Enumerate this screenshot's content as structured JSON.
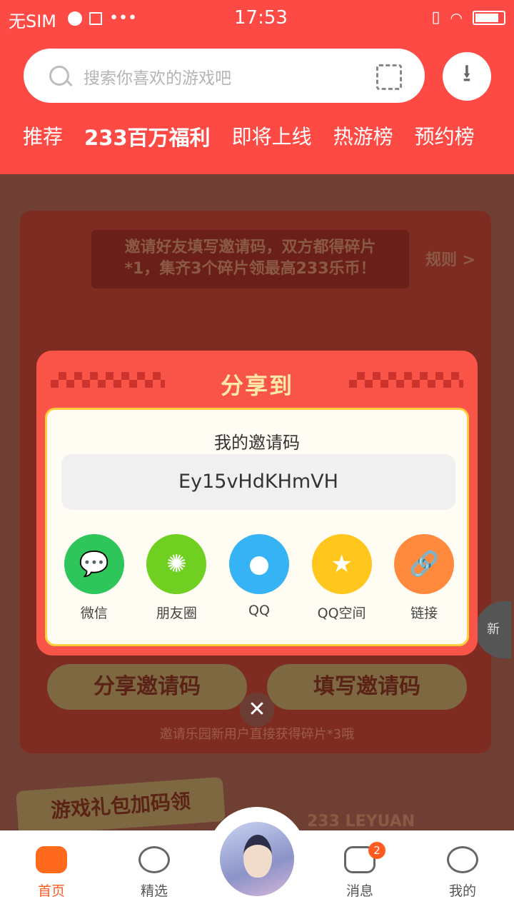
{
  "status_bar": {
    "carrier": "无SIM",
    "time": "17:53"
  },
  "search": {
    "placeholder": "搜索你喜欢的游戏吧"
  },
  "tabs": [
    "推荐",
    "233百万福利",
    "即将上线",
    "热游榜",
    "预约榜"
  ],
  "background": {
    "banner_text_1": "邀请好友填写邀请码，双方都得碎片",
    "banner_text_2": "*1，集齐3个碎片领最高233乐币！",
    "rule_link": "规则 >",
    "share_code_button": "分享邀请码",
    "enter_code_button": "填写邀请码",
    "note": "邀请乐园新用户直接获得碎片*3哦",
    "gift_banner": "游戏礼包加码领",
    "leyuan_text": "233 LEYUAN",
    "refresh_text": "新"
  },
  "modal": {
    "title": "分享到",
    "code_label": "我的邀请码",
    "invite_code": "Ey15vHdKHmVH",
    "share_options": [
      {
        "label": "微信",
        "icon": "wechat-icon",
        "color": "#2ec55a"
      },
      {
        "label": "朋友圈",
        "icon": "moments-icon",
        "color": "#6fd021"
      },
      {
        "label": "QQ",
        "icon": "qq-icon",
        "color": "#35b3f4"
      },
      {
        "label": "QQ空间",
        "icon": "qzone-icon",
        "color": "#ffc61d"
      },
      {
        "label": "链接",
        "icon": "link-icon",
        "color": "#ff8a3d"
      }
    ]
  },
  "bottom_nav": {
    "home": "首页",
    "featured": "精选",
    "messages": "消息",
    "messages_badge": "2",
    "me": "我的"
  }
}
